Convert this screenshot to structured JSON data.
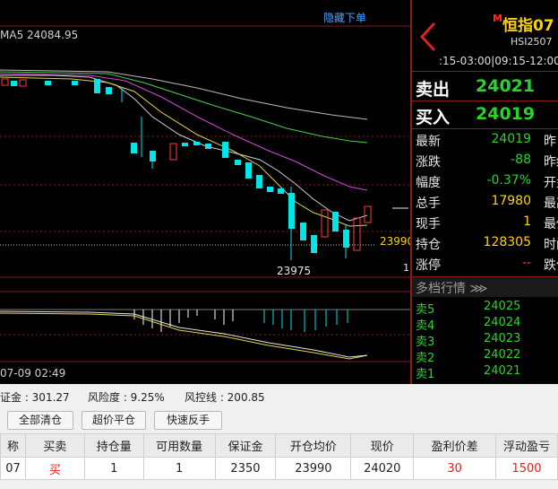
{
  "chart": {
    "hide_orders": "隐藏下单",
    "ma_label": "MA5 24084.95",
    "date_label": "07-09 02:49",
    "low_label": "23975",
    "price_tag": "23990",
    "one_tag": "1"
  },
  "panel": {
    "symbol_mark": "M",
    "symbol_name": "恒指07",
    "symbol_code": "HSI2507",
    "sessions": ":15-03:00|09:15-12:00",
    "sell_label": "卖出",
    "sell_value": "24021",
    "buy_label": "买入",
    "buy_value": "24019",
    "stats": [
      {
        "k": "最新",
        "v": "24019",
        "k2": "昨",
        "color": "green"
      },
      {
        "k": "涨跌",
        "v": "-88",
        "k2": "昨结",
        "color": "green"
      },
      {
        "k": "幅度",
        "v": "-0.37%",
        "k2": "开盘",
        "color": "green"
      },
      {
        "k": "总手",
        "v": "17980",
        "k2": "最高",
        "color": "yellow"
      },
      {
        "k": "现手",
        "v": "1",
        "k2": "最低",
        "color": "yellow"
      },
      {
        "k": "持仓",
        "v": "128305",
        "k2": "时间",
        "color": "yellow"
      },
      {
        "k": "涨停",
        "v": "--",
        "k2": "跌停",
        "color": "red"
      }
    ],
    "depth_title": "多档行情 ⋙",
    "depth": [
      {
        "k": "卖5",
        "v": "24025"
      },
      {
        "k": "卖4",
        "v": "24024"
      },
      {
        "k": "卖3",
        "v": "24023"
      },
      {
        "k": "卖2",
        "v": "24022"
      },
      {
        "k": "卖1",
        "v": "24021"
      }
    ]
  },
  "account": {
    "margin": "证金 : 301.27",
    "risk": "风险度 : 9.25%",
    "stop_line": "风控线 : 200.85"
  },
  "buttons": {
    "close_all": "全部清仓",
    "over_price_close": "超价平仓",
    "quick_reverse": "快速反手"
  },
  "table": {
    "headers": [
      "称",
      "买卖",
      "持仓量",
      "可用数量",
      "保证金",
      "开仓均价",
      "现价",
      "盈利价差",
      "浮动盈亏"
    ],
    "rows": [
      [
        "07",
        "买",
        "1",
        "1",
        "2350",
        "23990",
        "24020",
        "30",
        "1500"
      ]
    ]
  },
  "colors": {
    "up": "#ff3a3a",
    "down": "#2bd22b",
    "candle_up_hollow": "#ff3a3a",
    "candle_down": "#00e5e5",
    "grid": "#8b1a1a"
  }
}
